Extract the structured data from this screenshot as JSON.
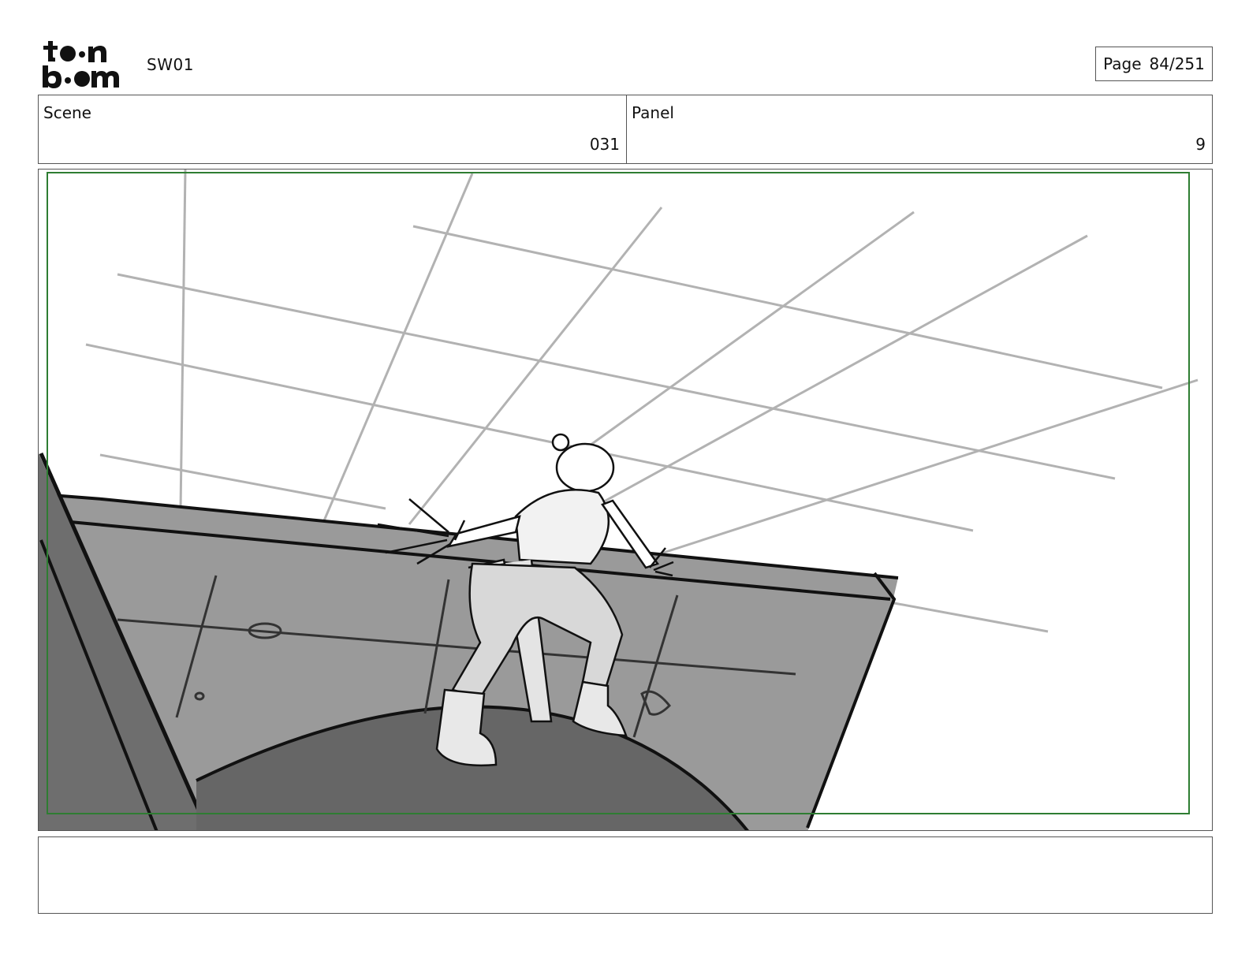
{
  "header": {
    "logo_text": "toonboom",
    "project": "SW01",
    "page_label": "Page",
    "page_value": "84/251"
  },
  "info": {
    "scene_label": "Scene",
    "scene_value": "031",
    "panel_label": "Panel",
    "panel_value": "9"
  },
  "notes": {
    "text": ""
  },
  "colors": {
    "safe_frame": "#2e7d32",
    "border": "#555555",
    "grid": "#b0b0b0"
  }
}
